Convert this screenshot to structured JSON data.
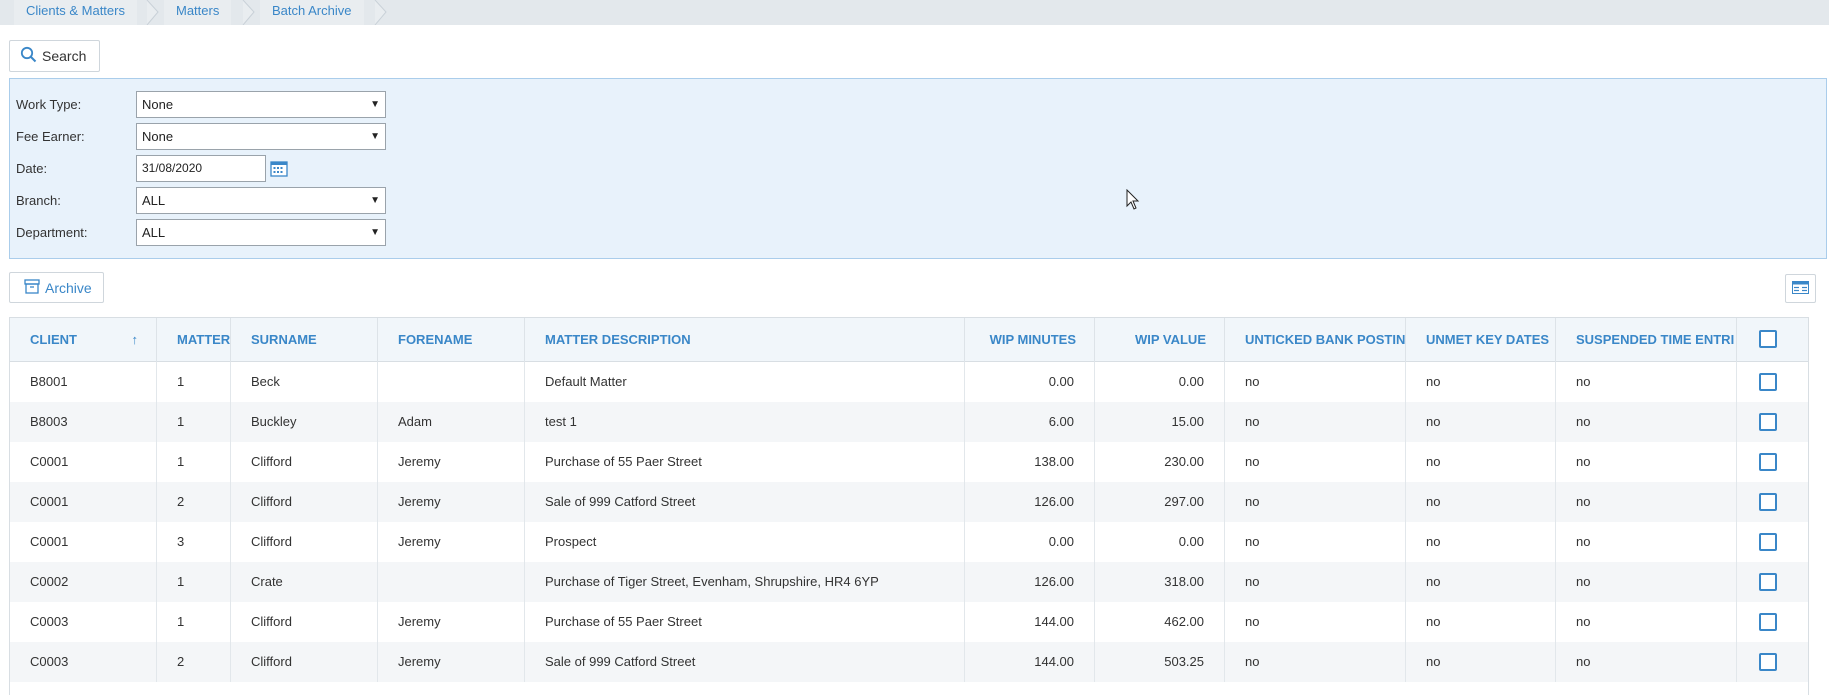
{
  "breadcrumb": [
    "Clients & Matters",
    "Matters",
    "Batch Archive"
  ],
  "toolbar": {
    "search_label": "Search",
    "archive_label": "Archive"
  },
  "filters": {
    "work_type": {
      "label": "Work Type:",
      "value": "None"
    },
    "fee_earner": {
      "label": "Fee Earner:",
      "value": "None"
    },
    "date": {
      "label": "Date:",
      "value": "31/08/2020"
    },
    "branch": {
      "label": "Branch:",
      "value": "ALL"
    },
    "department": {
      "label": "Department:",
      "value": "ALL"
    }
  },
  "table": {
    "columns": [
      "CLIENT",
      "MATTER",
      "SURNAME",
      "FORENAME",
      "MATTER DESCRIPTION",
      "WIP MINUTES",
      "WIP VALUE",
      "UNTICKED BANK POSTIN",
      "UNMET KEY DATES",
      "SUSPENDED TIME ENTRI"
    ],
    "sort_indicator": "↑",
    "rows": [
      {
        "client": "B8001",
        "matter": "1",
        "surname": "Beck",
        "forename": "",
        "description": "Default Matter",
        "wip_minutes": "0.00",
        "wip_value": "0.00",
        "unticked": "no",
        "unmet": "no",
        "suspended": "no"
      },
      {
        "client": "B8003",
        "matter": "1",
        "surname": "Buckley",
        "forename": "Adam",
        "description": "test 1",
        "wip_minutes": "6.00",
        "wip_value": "15.00",
        "unticked": "no",
        "unmet": "no",
        "suspended": "no"
      },
      {
        "client": "C0001",
        "matter": "1",
        "surname": "Clifford",
        "forename": "Jeremy",
        "description": "Purchase of 55 Paer Street",
        "wip_minutes": "138.00",
        "wip_value": "230.00",
        "unticked": "no",
        "unmet": "no",
        "suspended": "no"
      },
      {
        "client": "C0001",
        "matter": "2",
        "surname": "Clifford",
        "forename": "Jeremy",
        "description": "Sale of 999 Catford Street",
        "wip_minutes": "126.00",
        "wip_value": "297.00",
        "unticked": "no",
        "unmet": "no",
        "suspended": "no"
      },
      {
        "client": "C0001",
        "matter": "3",
        "surname": "Clifford",
        "forename": "Jeremy",
        "description": "Prospect",
        "wip_minutes": "0.00",
        "wip_value": "0.00",
        "unticked": "no",
        "unmet": "no",
        "suspended": "no"
      },
      {
        "client": "C0002",
        "matter": "1",
        "surname": "Crate",
        "forename": "",
        "description": "Purchase of Tiger Street, Evenham, Shrupshire, HR4 6YP",
        "wip_minutes": "126.00",
        "wip_value": "318.00",
        "unticked": "no",
        "unmet": "no",
        "suspended": "no"
      },
      {
        "client": "C0003",
        "matter": "1",
        "surname": "Clifford",
        "forename": "Jeremy",
        "description": "Purchase of 55 Paer Street",
        "wip_minutes": "144.00",
        "wip_value": "462.00",
        "unticked": "no",
        "unmet": "no",
        "suspended": "no"
      },
      {
        "client": "C0003",
        "matter": "2",
        "surname": "Clifford",
        "forename": "Jeremy",
        "description": "Sale of 999 Catford Street",
        "wip_minutes": "144.00",
        "wip_value": "503.25",
        "unticked": "no",
        "unmet": "no",
        "suspended": "no"
      }
    ]
  },
  "colors": {
    "accent": "#3a87c8",
    "filter_bg": "#e8f2fb",
    "filter_border": "#aacdeb",
    "header_bg": "#f1f6fa",
    "alt_row": "#f4f6f8"
  },
  "icons": {
    "search": "search-icon",
    "archive": "archive-icon",
    "calendar": "calendar-icon",
    "columns": "column-chooser-icon",
    "select_all": "checkbox-icon"
  }
}
